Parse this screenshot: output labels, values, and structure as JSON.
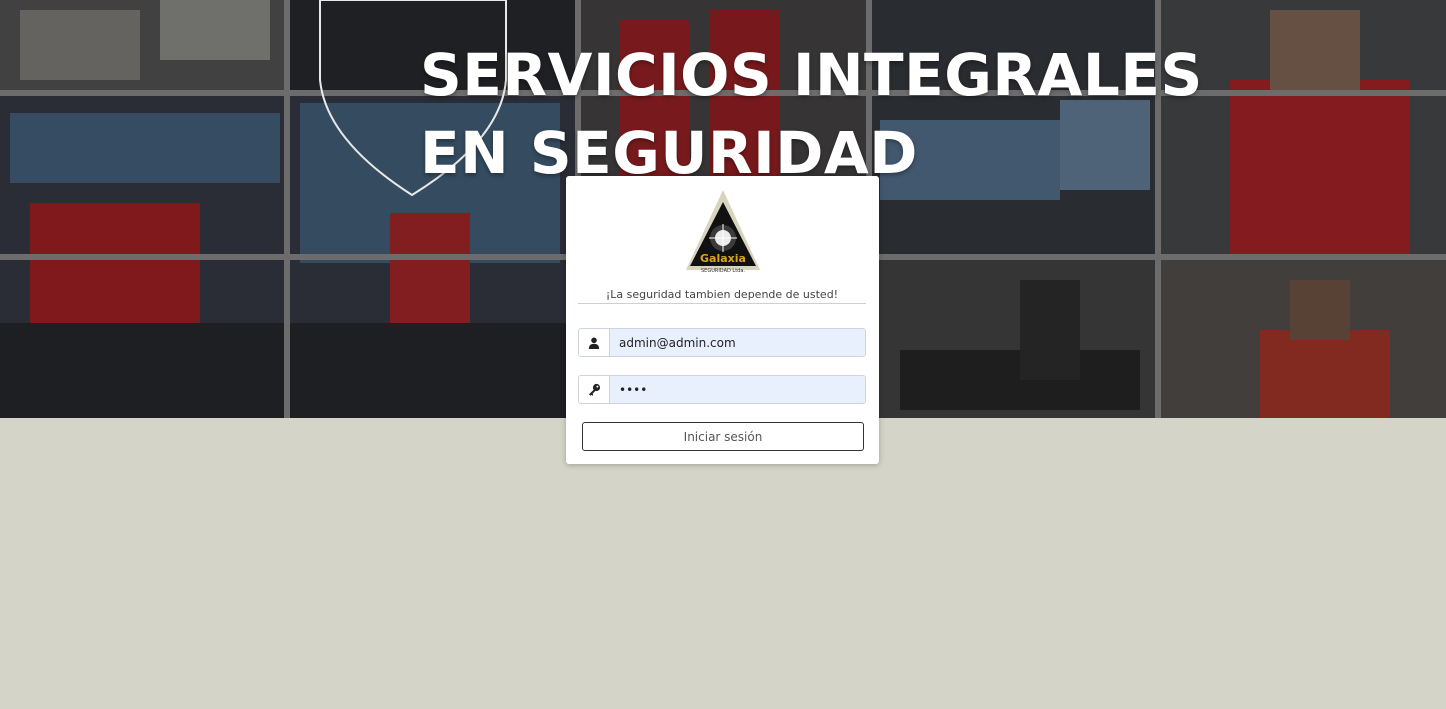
{
  "hero": {
    "title_line1": "SERVICIOS INTEGRALES",
    "title_line2": "EN SEGURIDAD"
  },
  "login": {
    "logo_text": "Galaxia",
    "logo_subtext": "SEGURIDAD Ltda.",
    "tagline": "¡La seguridad tambien depende de usted!",
    "email_value": "admin@admin.com",
    "email_icon": "user-icon",
    "password_value": "••••",
    "password_icon": "key-icon",
    "submit_label": "Iniciar sesión"
  },
  "colors": {
    "page_background": "#d4d4c8",
    "card_background": "#ffffff",
    "input_fill": "#e8f0fe",
    "uniform_red": "#c0262b"
  }
}
